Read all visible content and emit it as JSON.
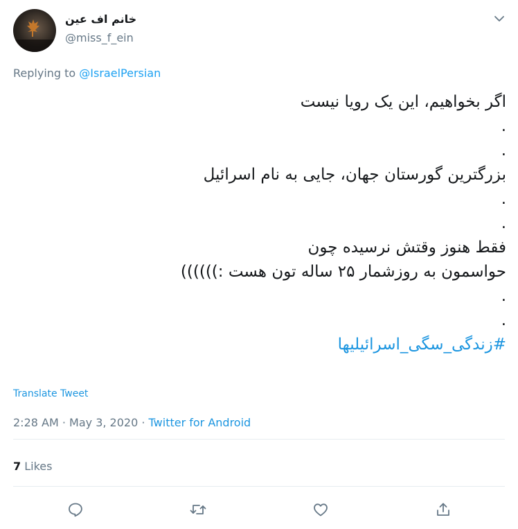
{
  "user": {
    "display_name": "خانم اف عین",
    "handle": "@miss_f_ein"
  },
  "reply": {
    "prefix": "Replying to ",
    "to": "@IsraelPersian"
  },
  "tweet": {
    "lines": [
      "اگر بخواهیم، این یک رویا نیست",
      ".",
      ".",
      "بزرگترین گورستان جهان، جایی به نام اسرائیل",
      ".",
      ".",
      "فقط هنوز وقتش نرسیده چون",
      "حواسمون به روزشمار ۲۵ ساله تون هست :))))))",
      ".",
      "."
    ],
    "hashtag": "#زندگی_سگی_اسرائیلیها"
  },
  "translate_label": "Translate Tweet",
  "meta": {
    "time": "2:28 AM",
    "separator1": " · ",
    "date": "May 3, 2020",
    "separator2": " · ",
    "source": "Twitter for Android"
  },
  "stats": {
    "likes_count": "7",
    "likes_label": " Likes"
  },
  "actions": [
    "reply-icon",
    "retweet-icon",
    "like-icon",
    "share-icon"
  ],
  "colors": {
    "accent": "#1da1f2",
    "secondary_text": "#657786",
    "divider": "#e6ecf0"
  }
}
